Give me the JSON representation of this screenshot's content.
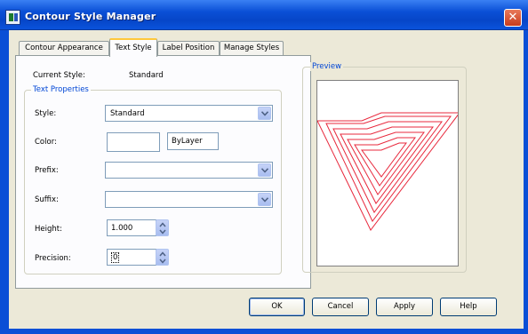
{
  "window": {
    "title": "Contour Style Manager",
    "close_symbol": "✕"
  },
  "tabs": [
    {
      "label": "Contour Appearance",
      "active": false
    },
    {
      "label": "Text Style",
      "active": true
    },
    {
      "label": "Label Position",
      "active": false
    },
    {
      "label": "Manage Styles",
      "active": false
    }
  ],
  "current_style": {
    "label": "Current Style:",
    "value": "Standard"
  },
  "text_properties": {
    "group_label": "Text Properties",
    "style": {
      "label": "Style:",
      "value": "Standard"
    },
    "color": {
      "label": "Color:",
      "value": "ByLayer"
    },
    "prefix": {
      "label": "Prefix:",
      "value": ""
    },
    "suffix": {
      "label": "Suffix:",
      "value": ""
    },
    "height": {
      "label": "Height:",
      "value": "1.000"
    },
    "precision": {
      "label": "Precision:",
      "value": "0"
    }
  },
  "preview": {
    "label": "Preview",
    "line_color": "#e8283c"
  },
  "buttons": {
    "ok": "OK",
    "cancel": "Cancel",
    "apply": "Apply",
    "help": "Help"
  },
  "colors": {
    "title_bar": "#0a4fd6",
    "accent": "#0046d5",
    "dialog_bg": "#ece9d8"
  }
}
